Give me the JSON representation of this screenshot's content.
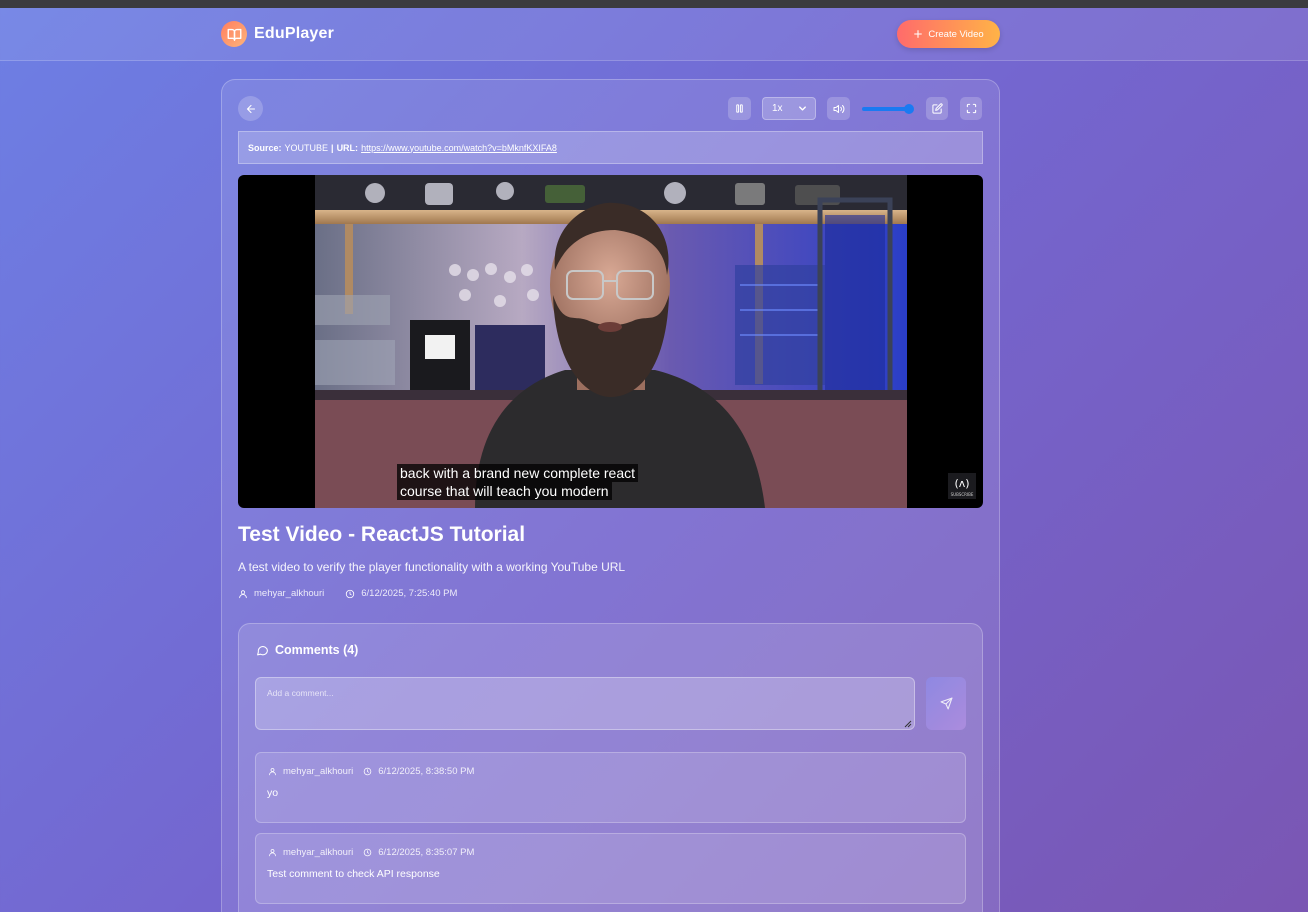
{
  "app": {
    "name": "EduPlayer",
    "create_button": "Create Video"
  },
  "player": {
    "speed": "1x",
    "volume_level": 1.0,
    "source_label": "Source:",
    "source_value": "YOUTUBE",
    "separator": "|",
    "url_label": "URL:",
    "url": "https://www.youtube.com/watch?v=bMknfKXIFA8",
    "caption_line1": "back with a brand new complete react",
    "caption_line2": "course that will teach you modern",
    "channel_badge": "SUBSCRIBE",
    "watermark": "freeCodeCamp(A)"
  },
  "video": {
    "title": "Test Video - ReactJS Tutorial",
    "description": "A test video to verify the player functionality with a working YouTube URL",
    "author": "mehyar_alkhouri",
    "created": "6/12/2025, 7:25:40 PM"
  },
  "comments": {
    "header": "Comments (4)",
    "placeholder": "Add a comment...",
    "items": [
      {
        "author": "mehyar_alkhouri",
        "time": "6/12/2025, 8:38:50 PM",
        "text": "yo"
      },
      {
        "author": "mehyar_alkhouri",
        "time": "6/12/2025, 8:35:07 PM",
        "text": "Test comment to check API response"
      }
    ]
  },
  "icons": [
    "book-open-icon",
    "plus-icon",
    "arrow-left-icon",
    "pause-icon",
    "chevron-down-icon",
    "volume-icon",
    "edit-icon",
    "fullscreen-icon",
    "user-icon",
    "clock-icon",
    "message-circle-icon",
    "send-icon"
  ],
  "colors": {
    "accent": "#1a7af2",
    "create_start": "#ff6b6b",
    "create_end": "#ffb347"
  }
}
